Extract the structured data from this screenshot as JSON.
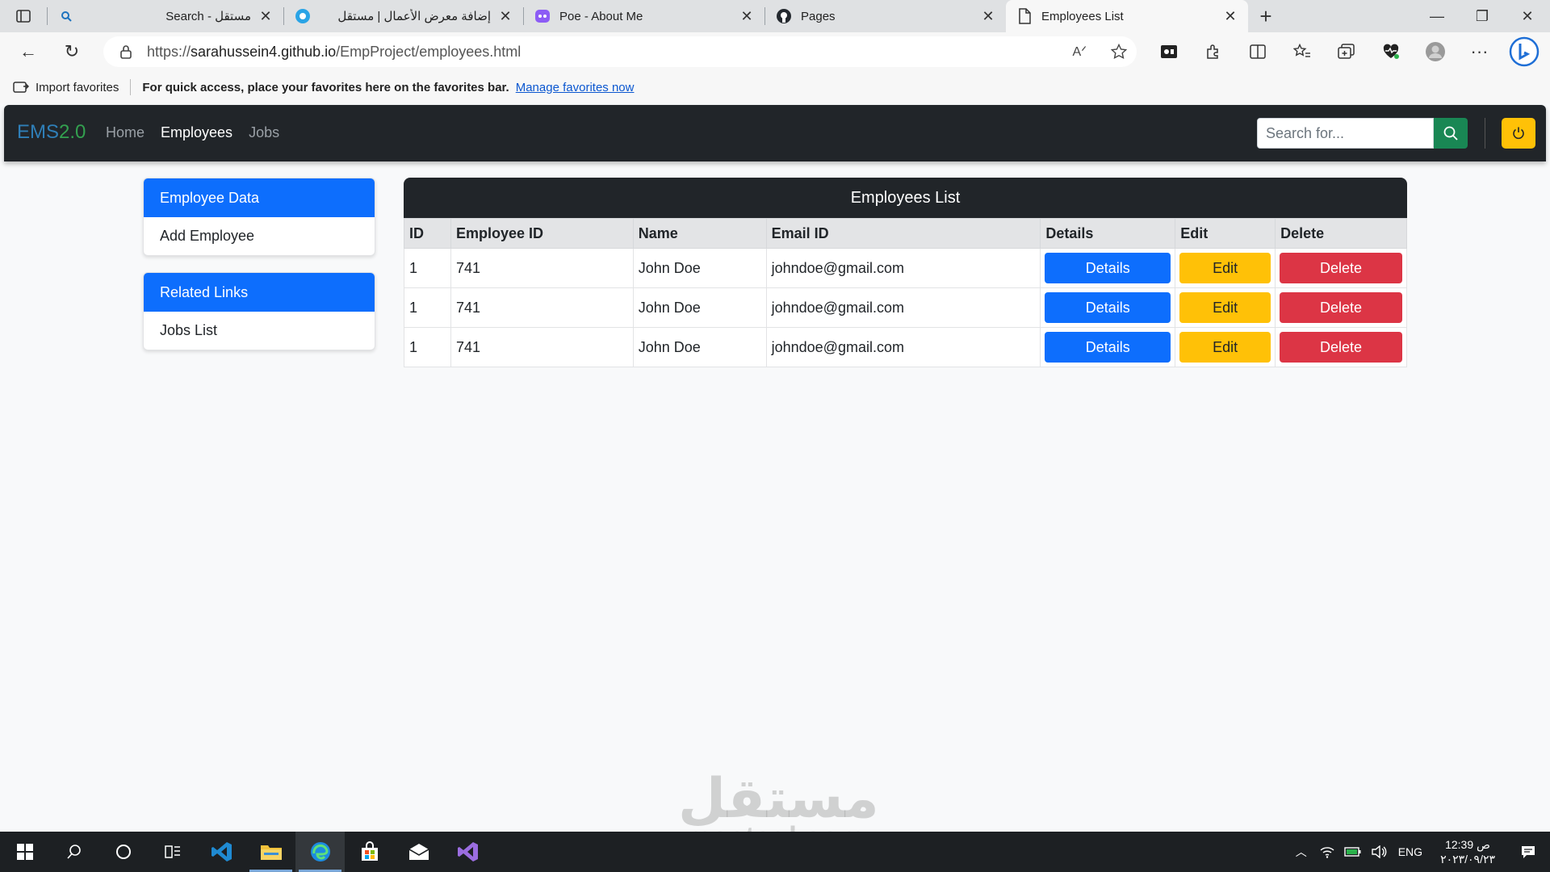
{
  "browser": {
    "tabs": [
      {
        "title": "Search - مستقل",
        "icon": "search-icon"
      },
      {
        "title": "إضافة معرض الأعمال | مستقل",
        "icon": "mostaql-icon"
      },
      {
        "title": "Poe - About Me",
        "icon": "poe-icon"
      },
      {
        "title": "Pages",
        "icon": "github-icon"
      },
      {
        "title": "Employees List",
        "icon": "page-icon",
        "active": true
      }
    ],
    "url_prefix": "https://",
    "url_host": "sarahussein4.github.io",
    "url_path": "/EmpProject/employees.html",
    "favorites": {
      "import_label": "Import favorites",
      "quick_text": "For quick access, place your favorites here on the favorites bar.",
      "manage_link": "Manage favorites now"
    }
  },
  "navbar": {
    "brand_main": "EMS",
    "brand_version": "2.0",
    "links": [
      {
        "label": "Home",
        "active": false
      },
      {
        "label": "Employees",
        "active": true
      },
      {
        "label": "Jobs",
        "active": false
      }
    ],
    "search_placeholder": "Search for..."
  },
  "sidebar": {
    "cards": [
      {
        "header": "Employee Data",
        "items": [
          "Add Employee"
        ]
      },
      {
        "header": "Related Links",
        "items": [
          "Jobs List"
        ]
      }
    ]
  },
  "employees": {
    "title": "Employees List",
    "columns": [
      "ID",
      "Employee ID",
      "Name",
      "Email ID",
      "Details",
      "Edit",
      "Delete"
    ],
    "rows": [
      {
        "id": "1",
        "employee_id": "741",
        "name": "John Doe",
        "email": "johndoe@gmail.com"
      },
      {
        "id": "1",
        "employee_id": "741",
        "name": "John Doe",
        "email": "johndoe@gmail.com"
      },
      {
        "id": "1",
        "employee_id": "741",
        "name": "John Doe",
        "email": "johndoe@gmail.com"
      }
    ],
    "details_label": "Details",
    "edit_label": "Edit",
    "delete_label": "Delete"
  },
  "watermark": {
    "arabic": "مستقل",
    "latin": "mostaql.com"
  },
  "taskbar": {
    "lang": "ENG",
    "time": "12:39 ص",
    "date": "٢٠٢٣/٠٩/٢٣"
  },
  "colors": {
    "primary": "#0d6efd",
    "warning": "#ffc107",
    "danger": "#dc3545",
    "success": "#198754",
    "dark": "#212529"
  }
}
